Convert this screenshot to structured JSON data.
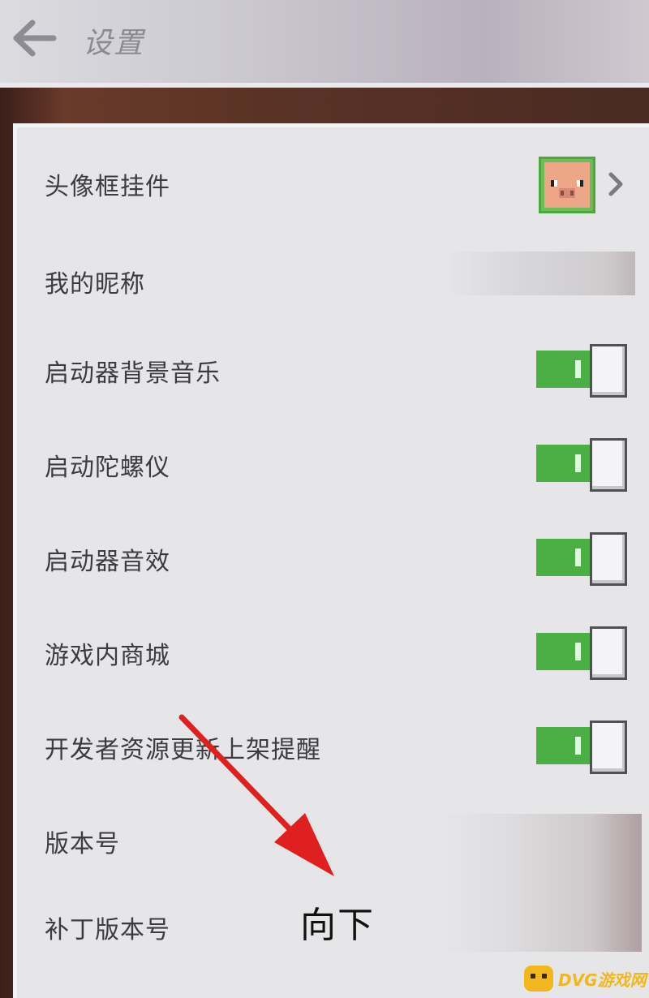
{
  "header": {
    "title": "设置"
  },
  "settings": {
    "avatar_frame": "头像框挂件",
    "nickname": "我的昵称",
    "launcher_bgm": "启动器背景音乐",
    "gyroscope": "启动陀螺仪",
    "launcher_sfx": "启动器音效",
    "in_game_store": "游戏内商城",
    "dev_resource_update": "开发者资源更新上架提醒",
    "version": "版本号",
    "patch_version": "补丁版本号"
  },
  "toggles": {
    "launcher_bgm": true,
    "gyroscope": true,
    "launcher_sfx": true,
    "in_game_store": true,
    "dev_resource_update": true
  },
  "annotation": {
    "text": "向下"
  },
  "watermark": {
    "text": "DVG游戏网"
  },
  "colors": {
    "toggle_on": "#4caf45",
    "arrow": "#e02020",
    "watermark": "#f2b71f"
  },
  "icons": [
    "back-arrow-icon",
    "chevron-right-icon",
    "pig-avatar-icon"
  ]
}
